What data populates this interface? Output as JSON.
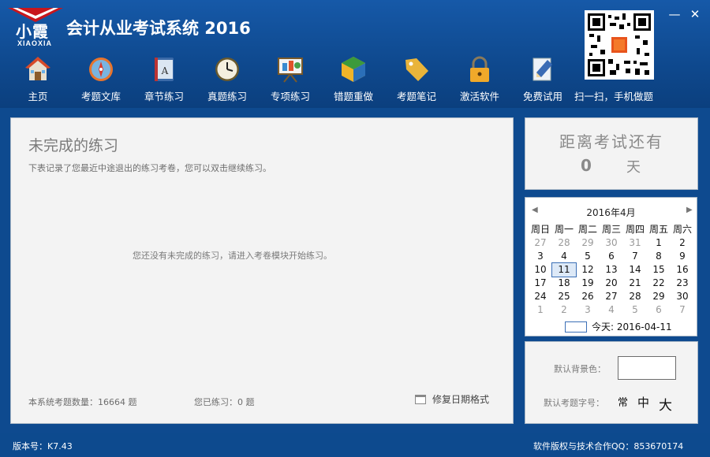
{
  "app": {
    "title": "会计从业考试系统 2016",
    "logo_cn": "小霞",
    "logo_en": "XIAOXIA"
  },
  "window": {
    "minimize": "—",
    "close": "✕"
  },
  "toolbar": {
    "items": [
      {
        "label": "主页",
        "icon": "home-icon"
      },
      {
        "label": "考题文库",
        "icon": "compass-icon"
      },
      {
        "label": "章节练习",
        "icon": "book-icon"
      },
      {
        "label": "真题练习",
        "icon": "clock-icon"
      },
      {
        "label": "专项练习",
        "icon": "presentation-icon"
      },
      {
        "label": "错题重做",
        "icon": "refresh-cube-icon"
      },
      {
        "label": "考题笔记",
        "icon": "tag-icon"
      },
      {
        "label": "激活软件",
        "icon": "lock-icon"
      },
      {
        "label": "免费试用",
        "icon": "pencil-icon"
      }
    ],
    "scan_label": "扫一扫，手机做题"
  },
  "main": {
    "title": "未完成的练习",
    "description": "下表记录了您最近中途退出的练习考卷，您可以双击继续练习。",
    "empty_message": "您还没有未完成的练习，请进入考卷模块开始练习。",
    "total_label": "本系统考题数量：16664 题",
    "practiced_label": "您已练习：0 题",
    "fix_date_label": "修复日期格式"
  },
  "countdown": {
    "title": "距离考试还有",
    "value": "0",
    "unit": "天"
  },
  "calendar": {
    "month_label": "2016年4月",
    "prev": "◀",
    "next": "▶",
    "weekdays": [
      "周日",
      "周一",
      "周二",
      "周三",
      "周四",
      "周五",
      "周六"
    ],
    "weeks": [
      [
        "27",
        "28",
        "29",
        "30",
        "31",
        "1",
        "2"
      ],
      [
        "3",
        "4",
        "5",
        "6",
        "7",
        "8",
        "9"
      ],
      [
        "10",
        "11",
        "12",
        "13",
        "14",
        "15",
        "16"
      ],
      [
        "17",
        "18",
        "19",
        "20",
        "21",
        "22",
        "23"
      ],
      [
        "24",
        "25",
        "26",
        "27",
        "28",
        "29",
        "30"
      ],
      [
        "1",
        "2",
        "3",
        "4",
        "5",
        "6",
        "7"
      ]
    ],
    "selected": "11",
    "today_label": "今天: 2016-04-11"
  },
  "settings": {
    "bg_label": "默认背景色：",
    "font_label": "默认考题字号：",
    "font_sizes": [
      "常",
      "中",
      "大"
    ]
  },
  "status": {
    "version": "版本号：K7.43",
    "copyright": "软件版权与技术合作QQ：853670174"
  },
  "colors": {
    "header_blue": "#0f4a90",
    "panel_bg": "#f3f3f3",
    "panel_border": "#a9b7c6"
  }
}
